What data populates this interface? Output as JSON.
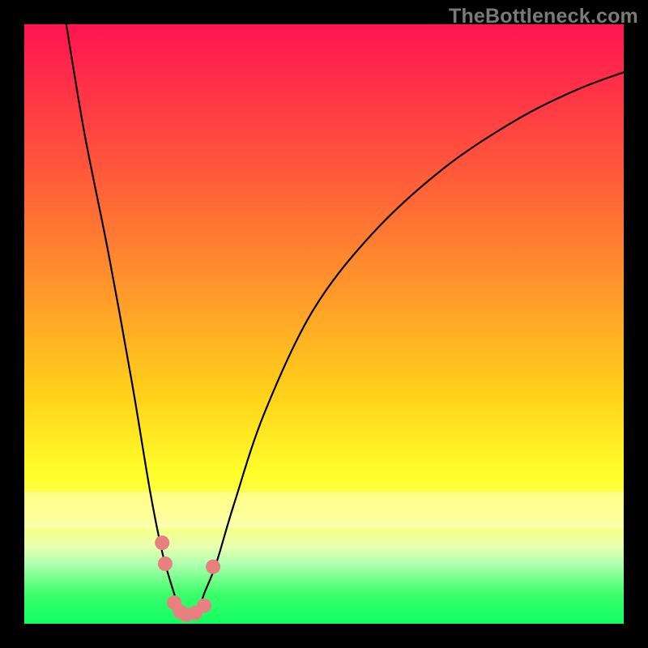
{
  "watermark": "TheBottleneck.com",
  "chart_data": {
    "type": "line",
    "title": "",
    "xlabel": "",
    "ylabel": "",
    "xlim": [
      0,
      100
    ],
    "ylim": [
      0,
      100
    ],
    "series": [
      {
        "name": "bottleneck-curve",
        "x": [
          7,
          10,
          14,
          18,
          21,
          23,
          25,
          26,
          27,
          28,
          29,
          30,
          32,
          35,
          40,
          48,
          58,
          70,
          82,
          92,
          100
        ],
        "y": [
          100,
          82,
          62,
          40,
          22,
          12,
          5,
          2,
          1,
          1,
          2,
          5,
          10,
          20,
          35,
          52,
          65,
          76,
          84,
          89,
          92
        ]
      }
    ],
    "markers": [
      {
        "x": 23.0,
        "y": 13.5
      },
      {
        "x": 23.5,
        "y": 10.0
      },
      {
        "x": 25.0,
        "y": 3.5
      },
      {
        "x": 26.0,
        "y": 2.0
      },
      {
        "x": 27.0,
        "y": 1.5
      },
      {
        "x": 28.5,
        "y": 1.8
      },
      {
        "x": 30.0,
        "y": 3.0
      },
      {
        "x": 31.5,
        "y": 9.5
      }
    ],
    "background_gradient": {
      "top": "#ff1450",
      "mid": "#ffff2a",
      "bottom": "#10ff62"
    }
  }
}
